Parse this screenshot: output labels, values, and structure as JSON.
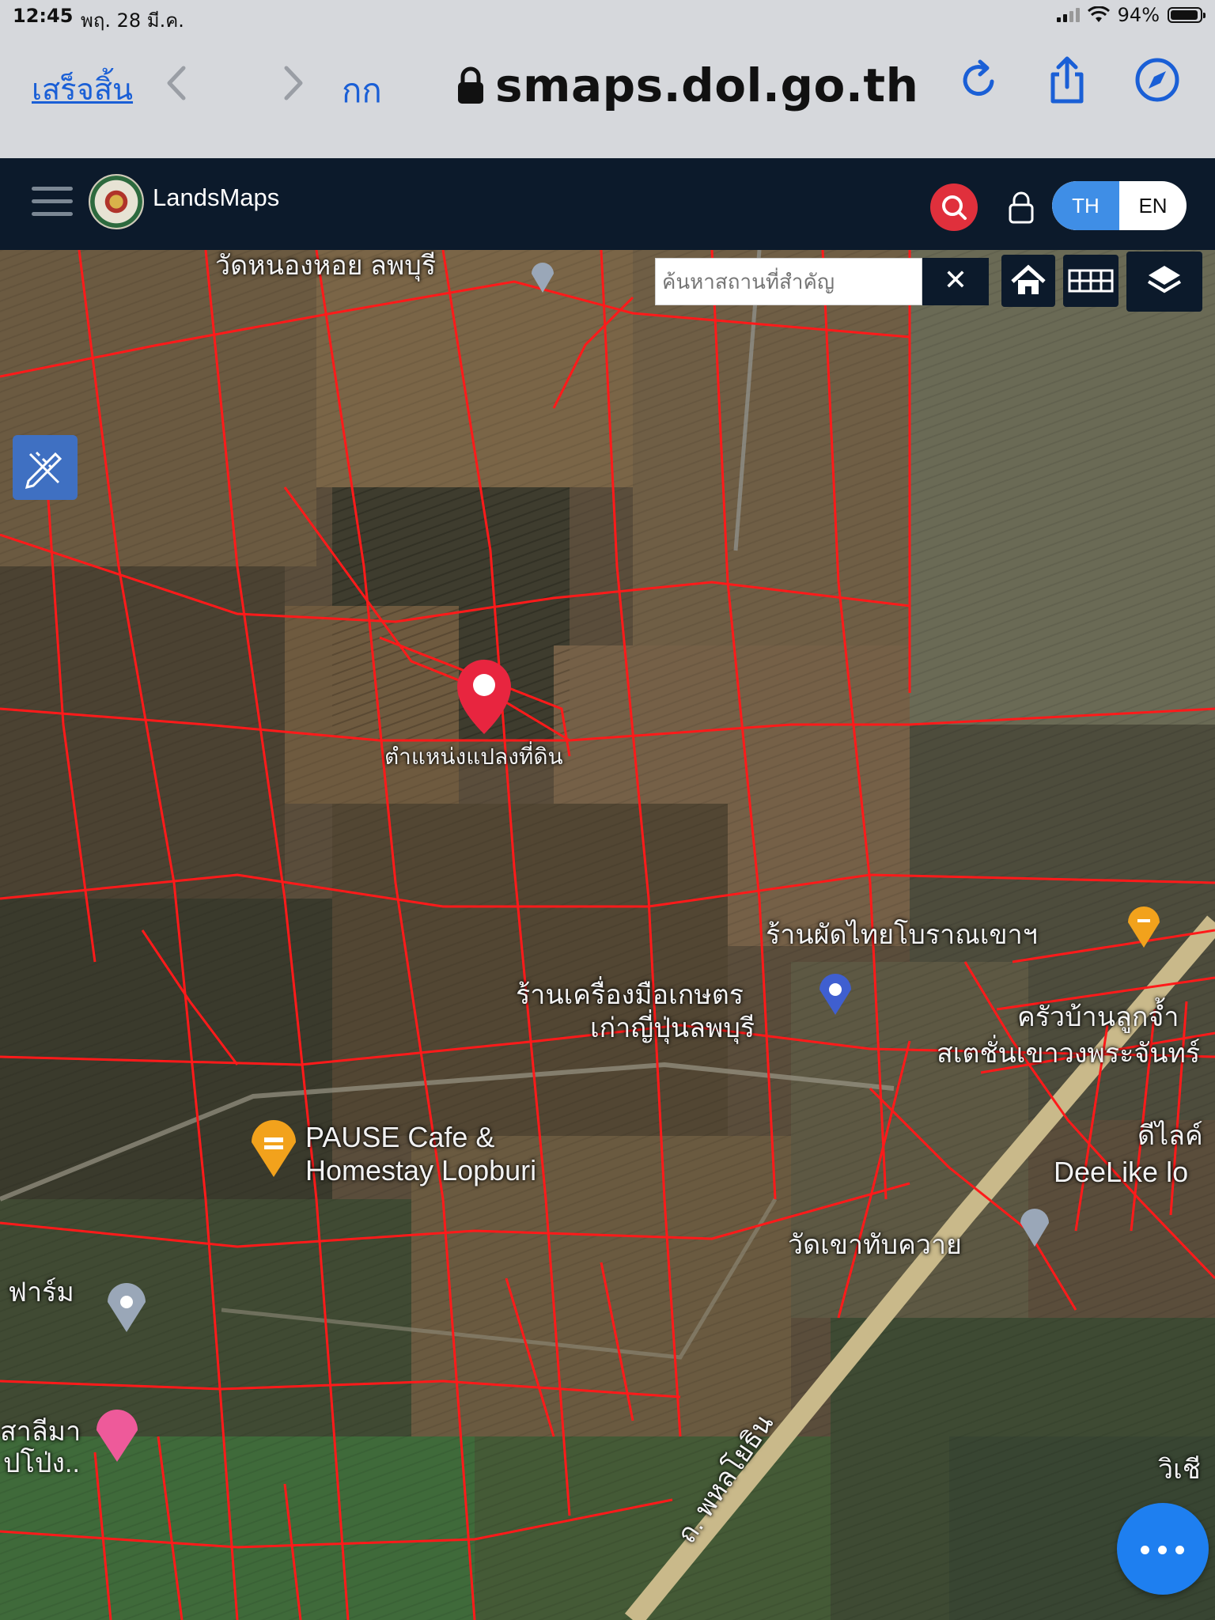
{
  "status_bar": {
    "time": "12:45",
    "date": "พฤ. 28 มี.ค.",
    "battery": "94%",
    "battery_level": 0.94
  },
  "browser": {
    "done_label": "เสร็จสิ้น",
    "text_size_label": "กก",
    "url": "smaps.dol.go.th",
    "icons": [
      "back-arrow-icon",
      "forward-arrow-icon",
      "lock-icon",
      "reload-icon",
      "share-icon",
      "compass-icon"
    ]
  },
  "app": {
    "brand": "LandsMaps",
    "lang": {
      "th": "TH",
      "en": "EN",
      "active": "TH"
    },
    "icons": [
      "hamburger-icon",
      "search-icon",
      "lock-icon"
    ]
  },
  "map": {
    "search_placeholder": "ค้นหาสถานที่สำคัญ",
    "clear_label": "✕",
    "controls": [
      "home-icon",
      "grid-icon",
      "layers-icon",
      "pencil-ruler-icon",
      "more-dots-icon"
    ],
    "marker_label": "ตำแหน่งแปลงที่ดิน",
    "labels": {
      "temple_top": "วัดหนองหอย ลพบุรี",
      "pad_thai": "ร้านผัดไทยโบราณเขาฯ",
      "tool_shop_1": "ร้านเครื่องมือเกษตร",
      "tool_shop_2": "เก่าญี่ปุ่นลพบุรี",
      "pause_1": "PAUSE Cafe &",
      "pause_2": "Homestay Lopburi",
      "temple_khao": "วัดเขาทับควาย",
      "farm": "ฟาร์ม",
      "road": "ถ. พหลโยธิน",
      "krua": "ครัวบ้านลูกจ้ำ",
      "station": "สเตชั่นเขาวงพระจันทร์",
      "deelike_th": "ดีไลค์",
      "deelike_en": "DeeLike lo",
      "left_bottom_1": "สาลีมา",
      "left_bottom_2": "ปโป่ง..",
      "wi": "วิเชี"
    },
    "accent_colors": {
      "parcel_lines": "#ff1a1a",
      "marker": "#e8253f",
      "fab": "#1e7ff0"
    }
  }
}
